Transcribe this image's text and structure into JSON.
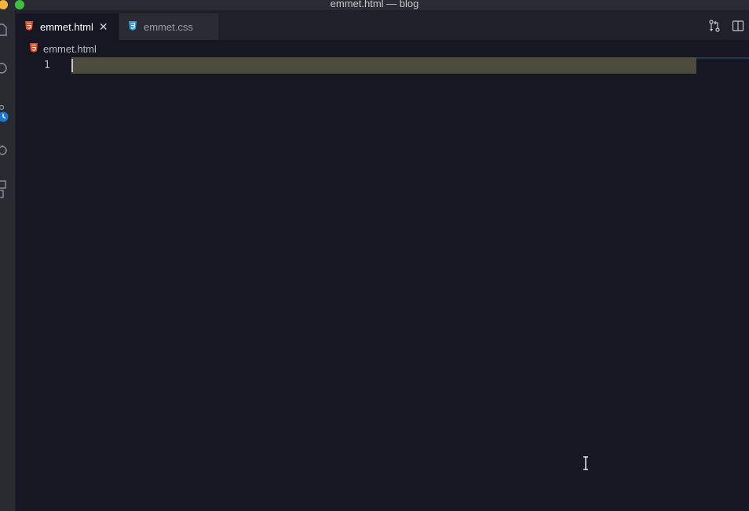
{
  "window": {
    "title": "emmet.html — blog"
  },
  "colors": {
    "html_icon": "#e44d26",
    "css_icon": "#2b9fdc",
    "source_control_badge": "#1a78d2"
  },
  "activity_bar": {
    "icons": [
      "files-icon",
      "search-icon",
      "source-control-icon",
      "debug-icon",
      "extensions-icon"
    ]
  },
  "tabs": [
    {
      "label": "emmet.html",
      "icon": "html5-icon",
      "active": true,
      "closable": true
    },
    {
      "label": "emmet.css",
      "icon": "css3-icon",
      "active": false,
      "closable": false
    }
  ],
  "tab_actions": [
    "open-changes-icon",
    "split-editor-icon"
  ],
  "breadcrumb": {
    "file": "emmet.html",
    "icon": "html5-icon"
  },
  "editor": {
    "lines": [
      {
        "number": "1",
        "text": ""
      }
    ]
  }
}
